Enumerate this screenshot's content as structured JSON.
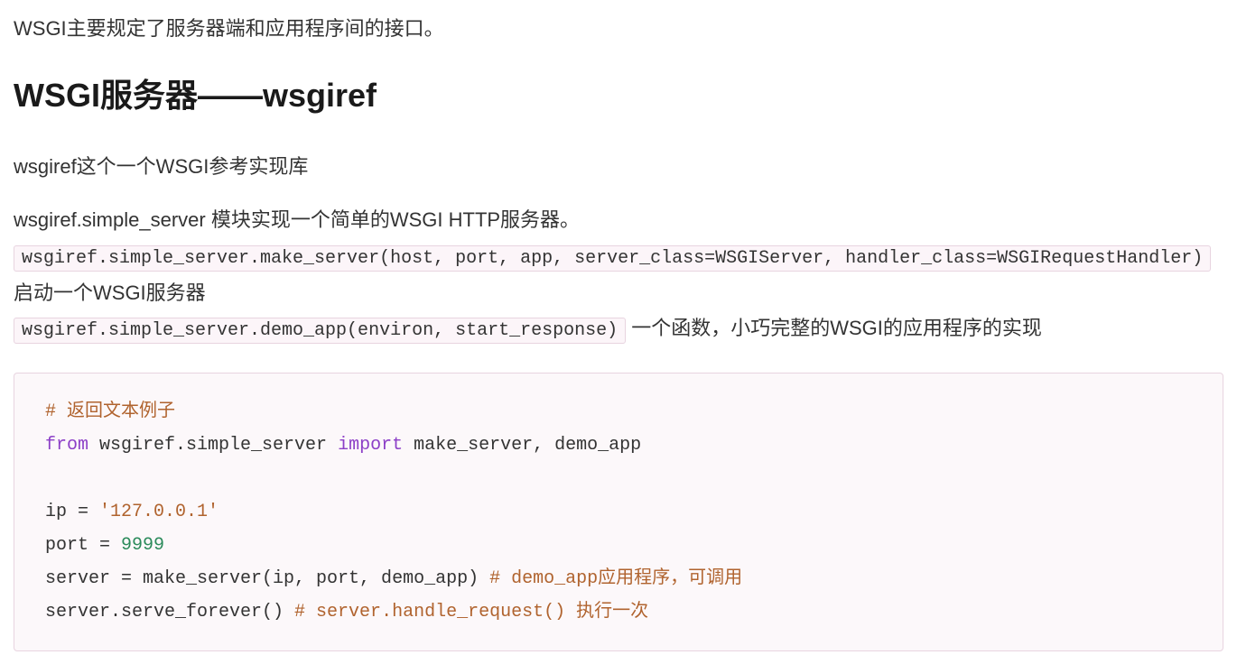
{
  "intro": "WSGI主要规定了服务器端和应用程序间的接口。",
  "heading": "WSGI服务器——wsgiref",
  "para1": "wsgiref这个一个WSGI参考实现库",
  "para2_prefix": "wsgiref.simple_server 模块实现一个简单的WSGI HTTP服务器。",
  "api1_code": "wsgiref.simple_server.make_server(host, port, app, server_class=WSGIServer, handler_class=WSGIRequestHandler)",
  "api1_desc": " 启动一个WSGI服务器",
  "api2_code": "wsgiref.simple_server.demo_app(environ, start_response)",
  "api2_desc": " 一个函数，小巧完整的WSGI的应用程序的实现",
  "code": {
    "l1_comment": "# 返回文本例子",
    "l2_from": "from",
    "l2_mod": " wsgiref.simple_server ",
    "l2_import": "import",
    "l2_names": " make_server, demo_app",
    "l4_lhs": "ip = ",
    "l4_str": "'127.0.0.1'",
    "l5_lhs": "port = ",
    "l5_num": "9999",
    "l6_lhs": "server = make_server(ip, port, demo_app) ",
    "l6_comment": "# demo_app应用程序，可调用",
    "l7_lhs": "server.serve_forever() ",
    "l7_comment": "# server.handle_request() 执行一次"
  }
}
